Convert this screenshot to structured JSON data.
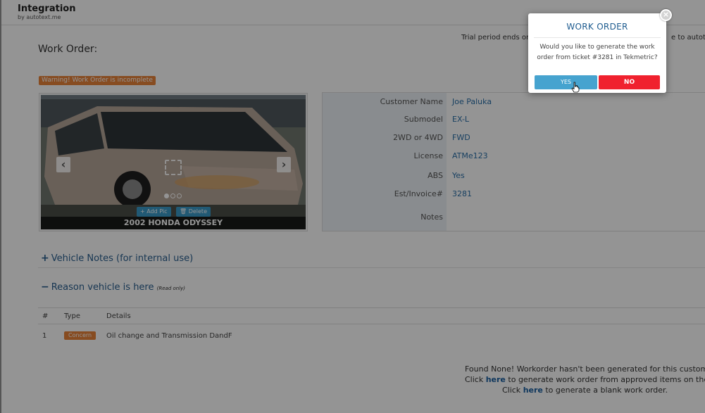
{
  "app": {
    "title": "Integration",
    "subtitle": "by autotext.me"
  },
  "trial": {
    "text": "Trial period ends on J",
    "text_right": "e to autotext"
  },
  "page": {
    "title": "Work Order:"
  },
  "warning": {
    "text": "Warning! Work Order is incomplete"
  },
  "vehicle": {
    "caption": "2002 HONDA ODYSSEY",
    "add_pic_label": "+ Add Pic",
    "delete_label": "Delete",
    "prev_icon": "chevron-left-icon",
    "next_icon": "chevron-right-icon"
  },
  "info": [
    {
      "label": "Customer Name",
      "value": "Joe Paluka"
    },
    {
      "label": "Submodel",
      "value": "EX-L"
    },
    {
      "label": "2WD or 4WD",
      "value": "FWD"
    },
    {
      "label": "License",
      "value": "ATMe123"
    },
    {
      "label": "ABS",
      "value": "Yes"
    },
    {
      "label": "Est/Invoice#",
      "value": "3281"
    },
    {
      "label": "Notes",
      "value": ""
    }
  ],
  "sections": {
    "vehicle_notes": {
      "symbol": "+",
      "label": "Vehicle Notes (for internal use)"
    },
    "reason": {
      "symbol": "−",
      "label": "Reason vehicle is here",
      "note": "(Read only)"
    }
  },
  "grid": {
    "headers": [
      "#",
      "Type",
      "Details"
    ],
    "rows": [
      {
        "num": "1",
        "type": "Concern",
        "details": "Oil change and Transmission DandF"
      }
    ]
  },
  "footer": {
    "line1": "Found None! Workorder hasn't been generated for this custome",
    "line2_pre": "Click ",
    "line2_link": "here",
    "line2_post": " to generate work order from approved items on the D",
    "line3_pre": "Click ",
    "line3_link": "here",
    "line3_post": " to generate a blank work order."
  },
  "modal": {
    "title": "WORK ORDER",
    "message": "Would you like to generate the work order from ticket #3281 in Tekmetric?",
    "yes_label": "YES",
    "no_label": "NO",
    "close_icon": "close-icon"
  },
  "colors": {
    "accent": "#1d5b8f",
    "yes": "#46a3cf",
    "no": "#f0212e",
    "warning": "#e8833a"
  }
}
